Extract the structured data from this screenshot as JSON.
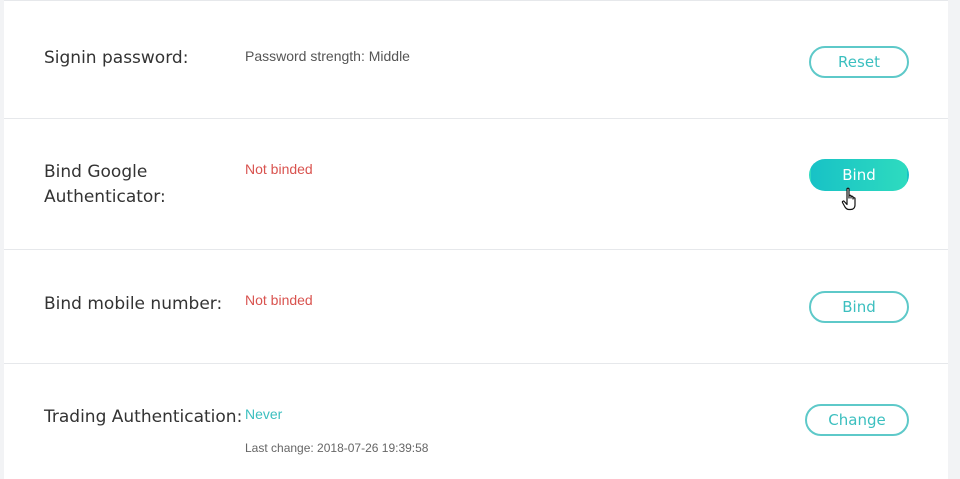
{
  "rows": [
    {
      "label": "Signin password:",
      "status": "Password strength: Middle",
      "button": "Reset"
    },
    {
      "label_line1": "Bind Google",
      "label_line2": "Authenticator:",
      "status": "Not binded",
      "button": "Bind"
    },
    {
      "label": "Bind mobile number:",
      "status": "Not binded",
      "button": "Bind"
    },
    {
      "label": "Trading Authentication:",
      "status": "Never",
      "sub": "Last change: 2018-07-26 19:39:58",
      "button": "Change"
    }
  ],
  "colors": {
    "accent": "#3bbfbf",
    "accent_gradient_start": "#18c2c6",
    "accent_gradient_end": "#2edbbf",
    "warning": "#d9534f",
    "label": "#333333",
    "divider": "#e6e8eb"
  },
  "icons": {
    "cursor": "hand-pointer-icon"
  }
}
